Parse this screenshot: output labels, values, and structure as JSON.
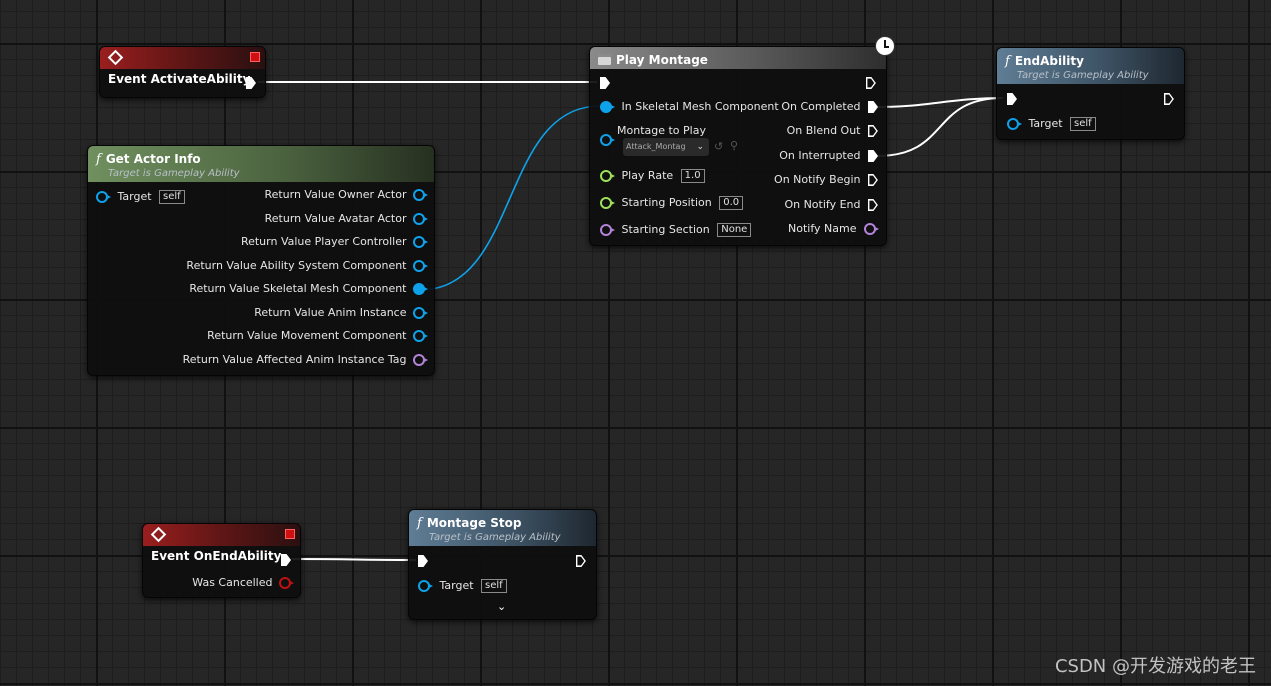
{
  "nodes": {
    "event_activate": {
      "title": "Event ActivateAbility"
    },
    "play_montage": {
      "title": "Play Montage",
      "inputs": {
        "skeletal_mesh": "In Skeletal Mesh Component",
        "montage_to_play": "Montage to Play",
        "montage_asset": "Attack_Montag",
        "play_rate": "Play Rate",
        "play_rate_value": "1.0",
        "starting_position": "Starting Position",
        "starting_position_value": "0.0",
        "starting_section": "Starting Section",
        "starting_section_value": "None"
      },
      "outputs": {
        "on_completed": "On Completed",
        "on_blend_out": "On Blend Out",
        "on_interrupted": "On Interrupted",
        "on_notify_begin": "On Notify Begin",
        "on_notify_end": "On Notify End",
        "notify_name": "Notify Name"
      }
    },
    "end_ability": {
      "title": "EndAbility",
      "subtitle": "Target is Gameplay Ability",
      "target_label": "Target",
      "target_value": "self"
    },
    "get_actor_info": {
      "title": "Get Actor Info",
      "subtitle": "Target is Gameplay Ability",
      "target_label": "Target",
      "target_value": "self",
      "outputs": [
        "Return Value Owner Actor",
        "Return Value Avatar Actor",
        "Return Value Player Controller",
        "Return Value Ability System Component",
        "Return Value Skeletal Mesh Component",
        "Return Value Anim Instance",
        "Return Value Movement Component",
        "Return Value Affected Anim Instance Tag"
      ]
    },
    "event_end": {
      "title": "Event OnEndAbility",
      "was_cancelled": "Was Cancelled"
    },
    "montage_stop": {
      "title": "Montage Stop",
      "subtitle": "Target is Gameplay Ability",
      "target_label": "Target",
      "target_value": "self"
    }
  },
  "watermark": "CSDN @开发游戏的老王",
  "colors": {
    "exec": "#ffffff",
    "object_pin": "#0ea2ea",
    "float_pin": "#9de05a",
    "name_pin": "#b383d8",
    "bool_pin": "#c01010",
    "event_header": "#9a1e1e",
    "function_header": "#5f7d95",
    "pure_function_header": "#70905f"
  }
}
